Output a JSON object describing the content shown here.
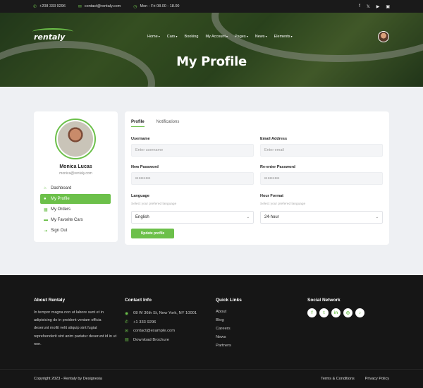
{
  "topbar": {
    "phone": "+208 333 9296",
    "email": "contact@rentaly.com",
    "hours": "Mon - Fri 08.00 - 18.00",
    "social": [
      "f",
      "𝕏",
      "▶",
      "▣"
    ]
  },
  "header": {
    "logo": "rentaly",
    "nav": [
      {
        "label": "Home",
        "dropdown": true
      },
      {
        "label": "Cars",
        "dropdown": true
      },
      {
        "label": "Booking",
        "dropdown": false
      },
      {
        "label": "My Account",
        "dropdown": true
      },
      {
        "label": "Pages",
        "dropdown": true
      },
      {
        "label": "News",
        "dropdown": true
      },
      {
        "label": "Elements",
        "dropdown": true
      }
    ],
    "page_title": "My Profile"
  },
  "sidebar": {
    "name": "Monica Lucas",
    "email": "monica@rentaly.com",
    "items": [
      {
        "label": "Dashboard",
        "icon": "home-icon",
        "glyph": "⌂",
        "active": false
      },
      {
        "label": "My Profile",
        "icon": "user-icon",
        "glyph": "●",
        "active": true
      },
      {
        "label": "My Orders",
        "icon": "calendar-icon",
        "glyph": "▦",
        "active": false
      },
      {
        "label": "My Favorite Cars",
        "icon": "car-icon",
        "glyph": "▬",
        "active": false
      },
      {
        "label": "Sign Out",
        "icon": "signout-icon",
        "glyph": "⇥",
        "active": false
      }
    ]
  },
  "profile": {
    "tabs": [
      "Profile",
      "Notifications"
    ],
    "username_label": "Username",
    "username_placeholder": "Enter username",
    "email_label": "Email Address",
    "email_placeholder": "Enter email",
    "new_password_label": "New Password",
    "new_password_value": "•••••••••",
    "reenter_password_label": "Re-enter Password",
    "reenter_password_value": "•••••••••",
    "language_label": "Language",
    "language_hint": "Select your prefered language",
    "language_value": "English",
    "hour_format_label": "Hour Format",
    "hour_format_hint": "Select your prefered language",
    "hour_format_value": "24-hour",
    "update_button": "Update profile"
  },
  "footer": {
    "about_title": "About Rentaly",
    "about_text": "In tempor magna non ut labore sunt et in adipisicing do in proident veniam officia deserunt mollit velit aliquip sint fugiat reprehenderit sint anim pariatur deserunt id in ut non.",
    "contact_title": "Contact Info",
    "contact": [
      {
        "text": "08 W 36th St, New York, NY 10001",
        "icon": "location-icon",
        "glyph": "◉"
      },
      {
        "text": "+1 333 9296",
        "icon": "phone-icon",
        "glyph": "✆"
      },
      {
        "text": "contact@example.com",
        "icon": "mail-icon",
        "glyph": "✉"
      },
      {
        "text": "Download Brochure",
        "icon": "file-icon",
        "glyph": "▤"
      }
    ],
    "links_title": "Quick Links",
    "links": [
      "About",
      "Blog",
      "Careers",
      "News",
      "Partners"
    ],
    "social_title": "Social Network",
    "social": [
      "f",
      "t",
      "in",
      "◎",
      "♪"
    ],
    "copyright": "Copyright 2023 - Rentaly by Designesia",
    "terms": "Terms & Conditions",
    "privacy": "Privacy Policy"
  },
  "colors": {
    "accent": "#6cc04a",
    "footer_bg": "#161616",
    "topbar_bg": "#1a1a1a"
  }
}
